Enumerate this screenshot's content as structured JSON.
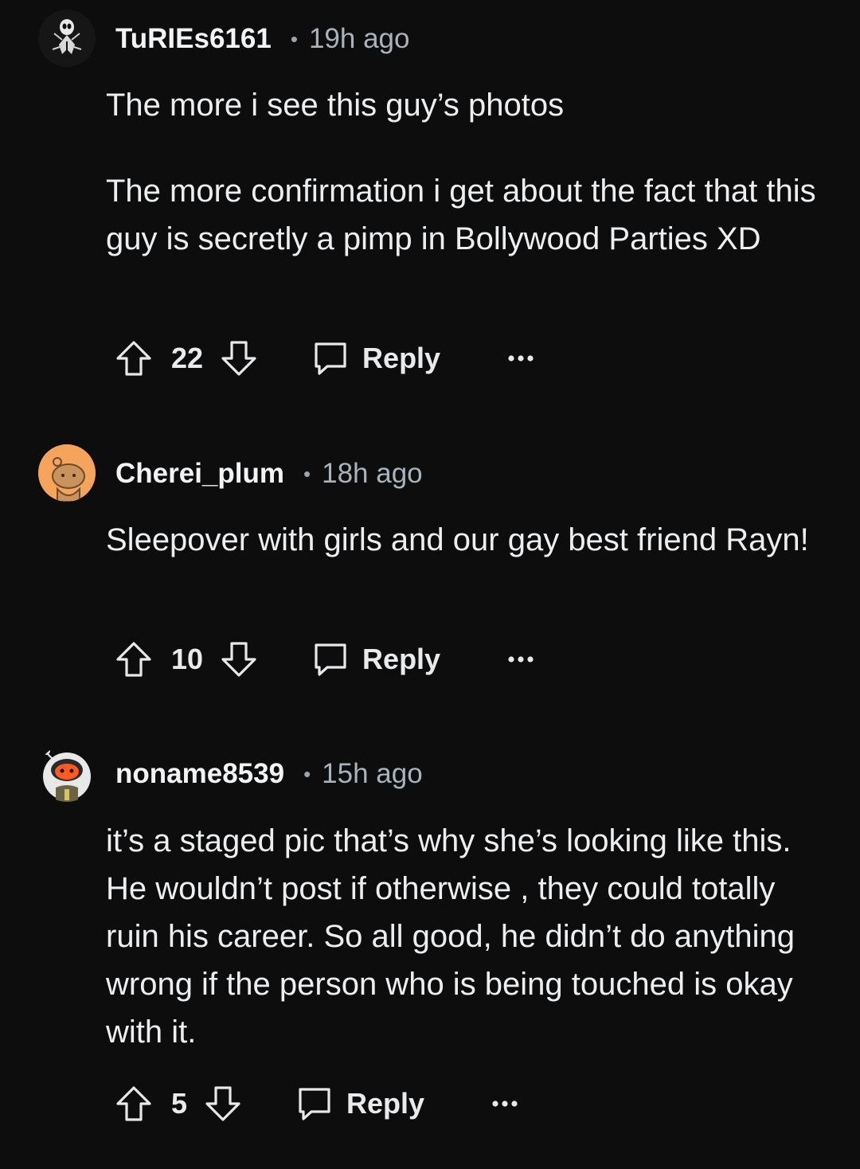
{
  "comments": [
    {
      "username": "TuRIEs6161",
      "separator": "•",
      "time": "19h ago",
      "avatar_icon": "spider-avatar-icon",
      "paragraphs": [
        "The more i see this guy’s photos",
        "The more confirmation i get about the fact that this guy is secretly a pimp in Bollywood Parties XD"
      ],
      "score": "22",
      "reply_label": "Reply",
      "more_label": "•••"
    },
    {
      "username": "Cherei_plum",
      "separator": "•",
      "time": "18h ago",
      "avatar_icon": "snoo-bear-avatar-icon",
      "paragraphs": [
        "Sleepover with girls and our gay best friend Rayn!"
      ],
      "score": "10",
      "reply_label": "Reply",
      "more_label": "•••"
    },
    {
      "username": "noname8539",
      "separator": "•",
      "time": "15h ago",
      "avatar_icon": "snoo-astronaut-avatar-icon",
      "paragraphs": [
        "it’s a staged pic that’s why she’s looking like this. He wouldn’t post if otherwise , they could totally ruin his career. So all good, he didn’t do anything wrong if the person who is being touched is okay with it."
      ],
      "score": "5",
      "reply_label": "Reply",
      "more_label": "•••"
    }
  ],
  "colors": {
    "background": "#0d0d0e",
    "text": "#eceef0",
    "muted": "#a9b3bc"
  }
}
